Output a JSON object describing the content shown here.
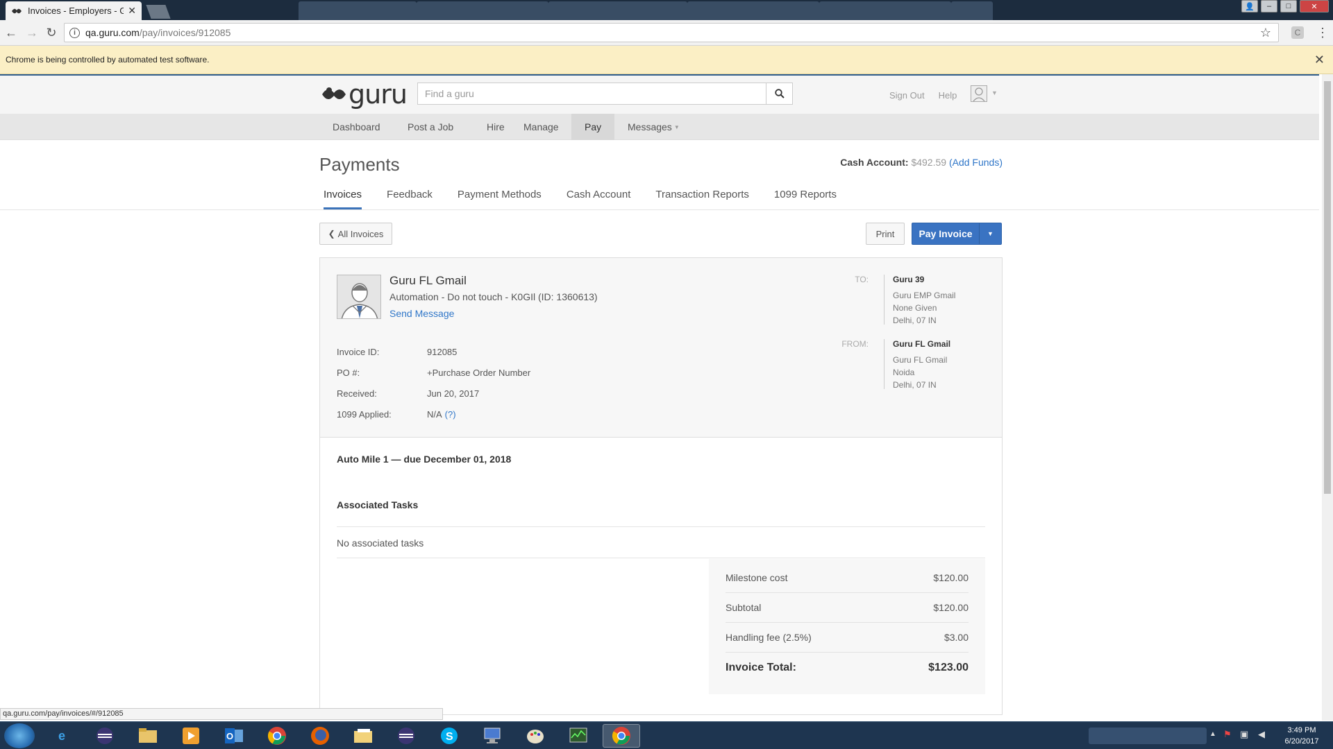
{
  "browser": {
    "tab_title": "Invoices - Employers - G",
    "url_host": "qa.guru.com",
    "url_path": "/pay/invoices/912085",
    "infobar_text": "Chrome is being controlled by automated test software.",
    "status_url": "qa.guru.com/pay/invoices/#/912085"
  },
  "header": {
    "logo_text": "guru",
    "search_placeholder": "Find a guru",
    "sign_out": "Sign Out",
    "help": "Help"
  },
  "main_nav": {
    "items": [
      "Dashboard",
      "Post a Job",
      "Hire",
      "Manage",
      "Pay",
      "Messages"
    ],
    "active": "Pay"
  },
  "page": {
    "title": "Payments",
    "cash_label": "Cash Account:",
    "cash_amount": "$492.59",
    "add_funds": "(Add Funds)",
    "subtabs": [
      "Invoices",
      "Feedback",
      "Payment Methods",
      "Cash Account",
      "Transaction Reports",
      "1099 Reports"
    ],
    "active_subtab": "Invoices"
  },
  "buttons": {
    "all_invoices": "All Invoices",
    "print": "Print",
    "pay_invoice": "Pay Invoice"
  },
  "invoice": {
    "freelancer_name": "Guru FL Gmail",
    "freelancer_sub": "Automation - Do not touch - K0GIl (ID: 1360613)",
    "send_message": "Send Message",
    "meta": [
      {
        "label": "Invoice ID:",
        "value": "912085"
      },
      {
        "label": "PO #:",
        "value": "+Purchase Order Number"
      },
      {
        "label": "Received:",
        "value": "Jun 20, 2017"
      },
      {
        "label": "1099 Applied:",
        "value": "N/A",
        "extra": "(?)"
      }
    ],
    "to": {
      "label": "TO:",
      "name": "Guru 39",
      "lines": [
        "Guru EMP Gmail",
        "None Given",
        "Delhi, 07 IN"
      ]
    },
    "from": {
      "label": "FROM:",
      "name": "Guru FL Gmail",
      "lines": [
        "Guru FL Gmail",
        "Noida",
        "Delhi, 07 IN"
      ]
    },
    "milestone": "Auto Mile 1 — due December 01, 2018",
    "associated_tasks_title": "Associated Tasks",
    "no_tasks": "No associated tasks",
    "summary": [
      {
        "label": "Milestone cost",
        "value": "$120.00"
      },
      {
        "label": "Subtotal",
        "value": "$120.00"
      },
      {
        "label": "Handling fee (2.5%)",
        "value": "$3.00"
      },
      {
        "label": "Invoice Total:",
        "value": "$123.00"
      }
    ]
  },
  "taskbar": {
    "apps": [
      "internet-explorer",
      "eclipse",
      "file-explorer",
      "media-player",
      "outlook",
      "chrome",
      "firefox",
      "folder",
      "eclipse",
      "skype",
      "network-tool",
      "paint",
      "task-manager",
      "chrome"
    ],
    "time": "3:49 PM",
    "date": "6/20/2017"
  },
  "colors": {
    "accent": "#3a73c2",
    "link": "#2f76c8",
    "infobar": "#fbefc5",
    "taskbar": "#1e3550"
  }
}
